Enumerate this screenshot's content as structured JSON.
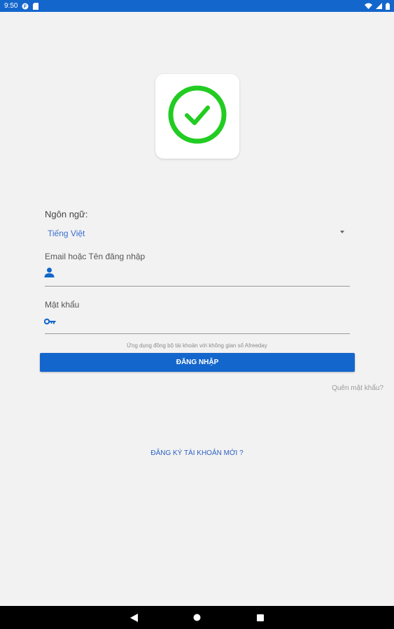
{
  "status_bar": {
    "time": "9:50",
    "icons": [
      "app-icon",
      "sim-icon",
      "wifi-icon",
      "signal-icon",
      "battery-icon"
    ]
  },
  "logo": {
    "icon": "check-circle-icon",
    "color": "#22cc22"
  },
  "language": {
    "label": "Ngôn ngữ:",
    "selected": "Tiếng Việt"
  },
  "email": {
    "label": "Email hoặc Tên đăng nhập",
    "value": "",
    "icon": "user-icon"
  },
  "password": {
    "label": "Mật khẩu",
    "value": "",
    "icon": "key-icon"
  },
  "sync_note": "Ứng dụng đồng bộ tài khoản với không gian số Afreeday",
  "login_button": "ĐĂNG NHẬP",
  "forgot_password": "Quên mật khẩu?",
  "register_link": "ĐĂNG KÝ TÀI KHOẢN MỚI ?",
  "nav": {
    "back": "back-icon",
    "home": "home-icon",
    "recents": "recents-icon"
  },
  "colors": {
    "primary": "#1366cc",
    "background": "#f2f2f2"
  }
}
